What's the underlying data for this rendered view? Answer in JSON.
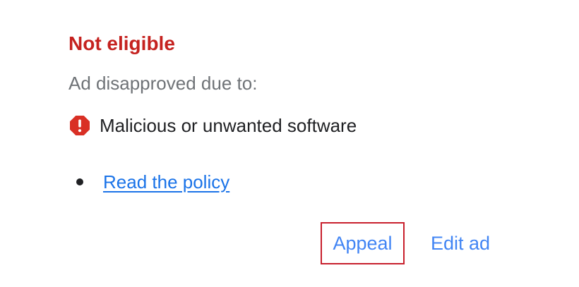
{
  "ad_status": {
    "title": "Not eligible",
    "reason_label": "Ad disapproved due to:",
    "issue": {
      "icon": "error-icon",
      "text": "Malicious or unwanted software"
    },
    "policy_link_label": "Read the policy",
    "actions": {
      "appeal_label": "Appeal",
      "edit_label": "Edit ad"
    }
  },
  "colors": {
    "status_red": "#c5221f",
    "icon_red": "#d93025",
    "link_blue": "#1a73e8",
    "action_blue": "#4285f4",
    "highlight_border": "#c8202d",
    "secondary_text": "#6f7377",
    "primary_text": "#202124"
  }
}
